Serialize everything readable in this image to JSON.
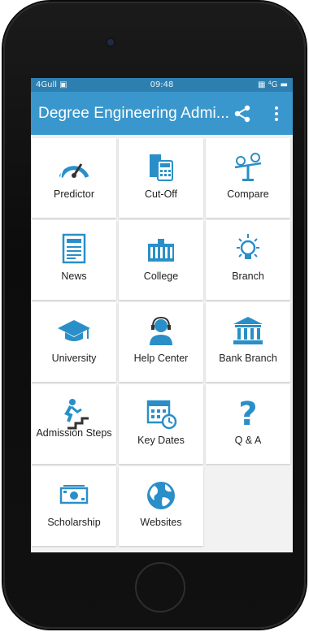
{
  "statusbar": {
    "left": "4Gull ▣",
    "time": "09:48",
    "right": "▦ ⁴G ▬"
  },
  "appbar": {
    "title": "Degree Engineering Admi...",
    "share_icon": "share-icon",
    "menu_icon": "more-vert-icon"
  },
  "colors": {
    "primary": "#3a97cd",
    "status": "#2d7fb0",
    "icon": "#2a8fc8"
  },
  "tiles": [
    {
      "label": "Predictor",
      "icon": "speedometer-icon"
    },
    {
      "label": "Cut-Off",
      "icon": "calculator-icon"
    },
    {
      "label": "Compare",
      "icon": "balance-scale-icon"
    },
    {
      "label": "News",
      "icon": "newspaper-icon"
    },
    {
      "label": "College",
      "icon": "building-icon"
    },
    {
      "label": "Branch",
      "icon": "lightbulb-icon"
    },
    {
      "label": "University",
      "icon": "graduation-cap-icon"
    },
    {
      "label": "Help Center",
      "icon": "headset-agent-icon"
    },
    {
      "label": "Bank Branch",
      "icon": "bank-icon"
    },
    {
      "label": "Admission Steps",
      "icon": "stairs-climb-icon"
    },
    {
      "label": "Key Dates",
      "icon": "calendar-clock-icon"
    },
    {
      "label": "Q & A",
      "icon": "question-mark-icon"
    },
    {
      "label": "Scholarship",
      "icon": "money-icon"
    },
    {
      "label": "Websites",
      "icon": "globe-icon"
    }
  ]
}
